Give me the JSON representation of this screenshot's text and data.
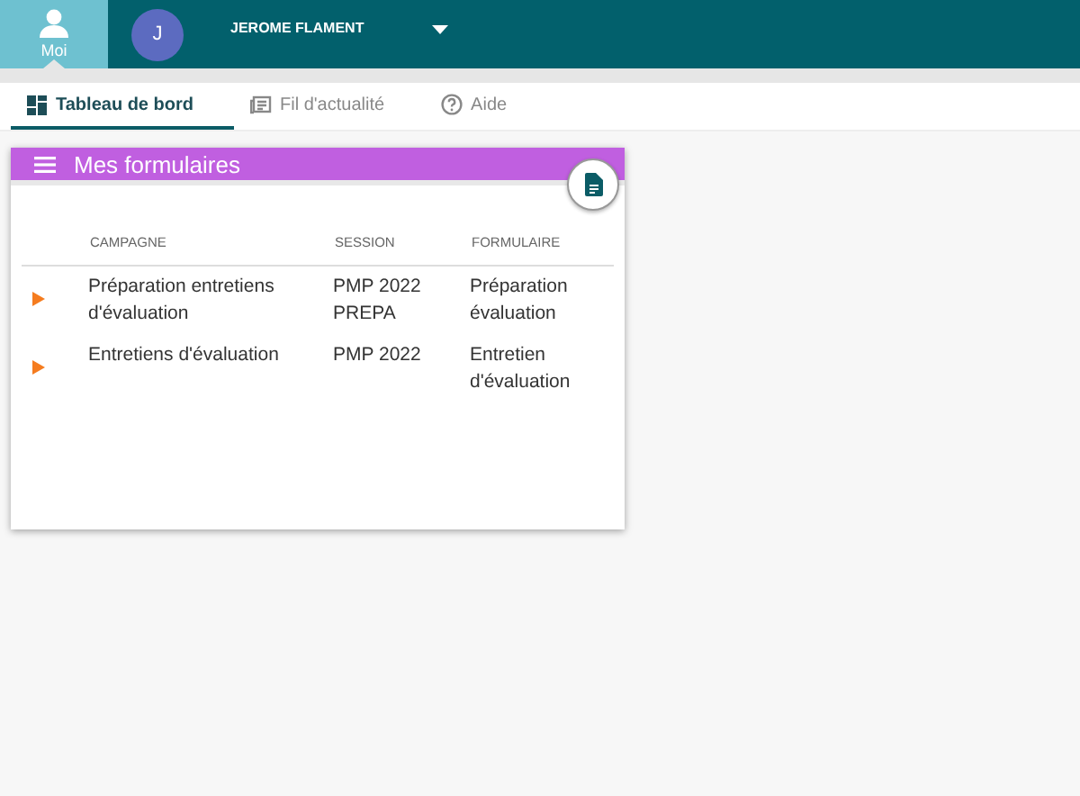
{
  "topbar": {
    "me_label": "Moi",
    "avatar_initial": "J",
    "user_name": "JEROME FLAMENT"
  },
  "tabs": [
    {
      "label": "Tableau de bord",
      "selected": true
    },
    {
      "label": "Fil d'actualité",
      "selected": false
    },
    {
      "label": "Aide",
      "selected": false
    }
  ],
  "card": {
    "title": "Mes formulaires",
    "columns": [
      "CAMPAGNE",
      "SESSION",
      "FORMULAIRE"
    ],
    "rows": [
      {
        "campagne": "Préparation entretiens d'évaluation",
        "session": "PMP 2022 PREPA",
        "formulaire": "Préparation évaluation"
      },
      {
        "campagne": "Entretiens d'évaluation",
        "session": "PMP 2022",
        "formulaire": "Entretien d'évaluation"
      }
    ]
  }
}
